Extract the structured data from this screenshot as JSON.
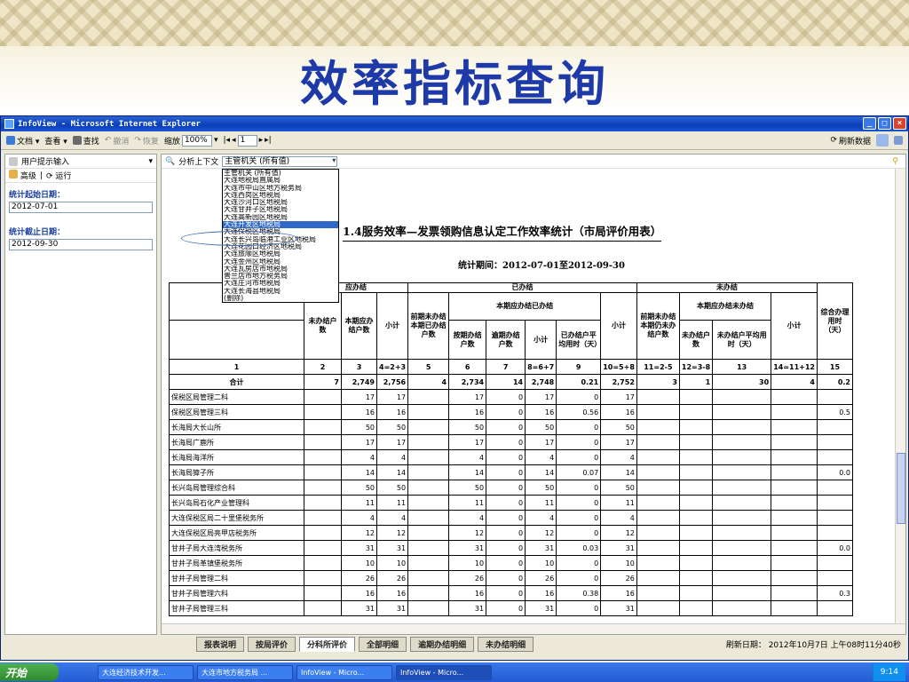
{
  "slide": {
    "title": "效率指标查询"
  },
  "window": {
    "title": "InfoView - Microsoft Internet Explorer",
    "buttons": [
      "_",
      "□",
      "×"
    ]
  },
  "toolbar": {
    "document": "文档 ▾",
    "view": "查看 ▾",
    "find": "查找",
    "undo": "撤消",
    "restore": "恢复",
    "zoom_label": "缩放",
    "zoom_value": "100%",
    "page_value": "1",
    "refresh_data": "刷新数据"
  },
  "left_panel": {
    "user_prompt": "用户提示输入",
    "advanced": "高级",
    "run": "运行",
    "start_label": "统计起始日期：",
    "start_value": "2012-07-01",
    "end_label": "统计截止日期：",
    "end_value": "2012-09-30"
  },
  "context": {
    "label": "分析上下文",
    "selected": "主管机关 (所有值)",
    "options": [
      "主管机关 (所有值)",
      "大连地税局直属局",
      "大连市中山区地方税务局",
      "大连西岗区地税局",
      "大连沙河口区地税局",
      "大连甘井子区地税局",
      "大连高新园区地税局",
      "大连开发区地税局",
      "大连保税区地税局",
      "大连长兴岛临港工业区地税局",
      "大连花园口经济区地税局",
      "大连旅顺区地税局",
      "大连金州区地税局",
      "大连瓦房店市地税局",
      "普兰店市地方税务局",
      "大连庄河市地税局",
      "大连长海县地税局",
      "(删除)"
    ],
    "selected_index": 7
  },
  "report": {
    "title": "1.4服务效率—发票领购信息认定工作效率统计（市局评价用表）",
    "period": "统计期间：2012-07-01至2012-09-30",
    "headers": {
      "g_due": "应办结",
      "g_done": "已办结",
      "g_undone": "未办结",
      "prev_pending": "未办结户数",
      "cur_due": "本期应办结户数",
      "subtotal": "小计",
      "prev_done": "前期未办结本期已办结户数",
      "cur_due_done": "本期应办结已办结",
      "ontime": "按期办结户数",
      "overdue": "逾期办结户数",
      "avg_done": "已办结户平均用时（天）",
      "still_pending": "前期未办结本期仍未办结户数",
      "cur_due_undone": "本期应办结未办结",
      "undone_cnt": "未办结户数",
      "avg_undone": "未办结户平均用时（天）",
      "overall": "综合办理用时（天）"
    },
    "index_row": [
      "1",
      "2",
      "3",
      "4=2+3",
      "5",
      "6",
      "7",
      "8=6+7",
      "9",
      "10=5+8",
      "11=2-5",
      "12=3-8",
      "13",
      "14=11+12",
      "15"
    ],
    "total_row": [
      "合计",
      "7",
      "2,749",
      "2,756",
      "4",
      "2,734",
      "14",
      "2,748",
      "0.21",
      "2,752",
      "3",
      "1",
      "30",
      "4",
      "0.2"
    ],
    "rows": [
      [
        "保税区局管理二科",
        "",
        "17",
        "17",
        "",
        "17",
        "0",
        "17",
        "0",
        "17",
        "",
        "",
        "",
        "",
        ""
      ],
      [
        "保税区局管理三科",
        "",
        "16",
        "16",
        "",
        "16",
        "0",
        "16",
        "0.56",
        "16",
        "",
        "",
        "",
        "",
        "0.5"
      ],
      [
        "长海局大长山所",
        "",
        "50",
        "50",
        "",
        "50",
        "0",
        "50",
        "0",
        "50",
        "",
        "",
        "",
        "",
        ""
      ],
      [
        "长海局广鹿所",
        "",
        "17",
        "17",
        "",
        "17",
        "0",
        "17",
        "0",
        "17",
        "",
        "",
        "",
        "",
        ""
      ],
      [
        "长海局海洋所",
        "",
        "4",
        "4",
        "",
        "4",
        "0",
        "4",
        "0",
        "4",
        "",
        "",
        "",
        "",
        ""
      ],
      [
        "长海局獐子所",
        "",
        "14",
        "14",
        "",
        "14",
        "0",
        "14",
        "0.07",
        "14",
        "",
        "",
        "",
        "",
        "0.0"
      ],
      [
        "长兴岛局管理综合科",
        "",
        "50",
        "50",
        "",
        "50",
        "0",
        "50",
        "0",
        "50",
        "",
        "",
        "",
        "",
        ""
      ],
      [
        "长兴岛局石化产业管理科",
        "",
        "11",
        "11",
        "",
        "11",
        "0",
        "11",
        "0",
        "11",
        "",
        "",
        "",
        "",
        ""
      ],
      [
        "大连保税区局二十里堡税务所",
        "",
        "4",
        "4",
        "",
        "4",
        "0",
        "4",
        "0",
        "4",
        "",
        "",
        "",
        "",
        ""
      ],
      [
        "大连保税区局亮甲店税务所",
        "",
        "12",
        "12",
        "",
        "12",
        "0",
        "12",
        "0",
        "12",
        "",
        "",
        "",
        "",
        ""
      ],
      [
        "甘井子局大连湾税务所",
        "",
        "31",
        "31",
        "",
        "31",
        "0",
        "31",
        "0.03",
        "31",
        "",
        "",
        "",
        "",
        "0.0"
      ],
      [
        "甘井子局革镇堡税务所",
        "",
        "10",
        "10",
        "",
        "10",
        "0",
        "10",
        "0",
        "10",
        "",
        "",
        "",
        "",
        ""
      ],
      [
        "甘井子局管理二科",
        "",
        "26",
        "26",
        "",
        "26",
        "0",
        "26",
        "0",
        "26",
        "",
        "",
        "",
        "",
        ""
      ],
      [
        "甘井子局管理六科",
        "",
        "16",
        "16",
        "",
        "16",
        "0",
        "16",
        "0.38",
        "16",
        "",
        "",
        "",
        "",
        "0.3"
      ],
      [
        "甘井子局管理三科",
        "",
        "31",
        "31",
        "",
        "31",
        "0",
        "31",
        "0",
        "31",
        "",
        "",
        "",
        "",
        ""
      ]
    ]
  },
  "tabs": [
    "报表说明",
    "按局评价",
    "分科所评价",
    "全部明细",
    "逾期办结明细",
    "未办结明细"
  ],
  "active_tab": 2,
  "status": {
    "refresh_date": "刷新日期： 2012年10月7日 上午08时11分40秒"
  },
  "taskbar": {
    "start": "开始",
    "tasks": [
      "大连经济技术开发...",
      "大连市地方税务局 ...",
      "InfoView - Micro...",
      "InfoView - Micro..."
    ],
    "clock": "9:14"
  }
}
